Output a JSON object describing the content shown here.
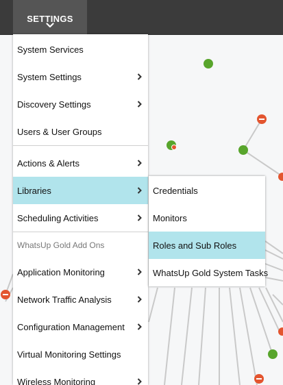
{
  "header": {
    "settings_label": "SETTINGS"
  },
  "menu": {
    "items": [
      {
        "label": "System Services"
      },
      {
        "label": "System Settings"
      },
      {
        "label": "Discovery Settings"
      },
      {
        "label": "Users & User Groups"
      },
      {
        "label": "Actions & Alerts"
      },
      {
        "label": "Libraries"
      },
      {
        "label": "Scheduling Activities"
      },
      {
        "label": "Application Monitoring"
      },
      {
        "label": "Network Traffic Analysis"
      },
      {
        "label": "Configuration Management"
      },
      {
        "label": "Virtual Monitoring Settings"
      },
      {
        "label": "Wireless Monitoring"
      }
    ],
    "addons_section": "WhatsUp Gold Add Ons",
    "active_item": "Libraries"
  },
  "submenu": {
    "items": [
      {
        "label": "Credentials"
      },
      {
        "label": "Monitors"
      },
      {
        "label": "Roles and Sub Roles"
      },
      {
        "label": "WhatsUp Gold System Tasks"
      }
    ],
    "hovered_item": "Roles and Sub Roles"
  },
  "colors": {
    "topbar": "#3b3b3b",
    "highlight": "#b1e4ec",
    "node_up": "#58a52c",
    "node_down": "#e3552f"
  },
  "icons": [
    "chevron-down-icon",
    "chevron-right-icon"
  ]
}
